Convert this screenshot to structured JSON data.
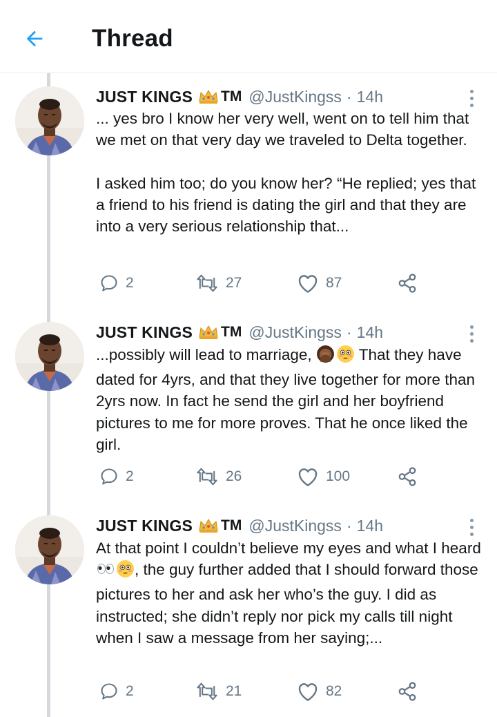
{
  "header": {
    "title": "Thread",
    "back_icon": "arrow-left-icon",
    "accent": "#1da1f2"
  },
  "tweets": [
    {
      "name": "JUST KINGS",
      "badge": "TM",
      "handle": "@JustKingss",
      "dot": "·",
      "time": "14h",
      "body": [
        "... yes bro I know her very well, went on to tell him that we met on that very day we traveled to Delta together.",
        "I asked him too; do you know her? “He replied; yes that a friend to his friend is dating the girl and that they are into a very serious relationship that..."
      ],
      "replies": "2",
      "retweets": "27",
      "likes": "87"
    },
    {
      "name": "JUST KINGS",
      "badge": "TM",
      "handle": "@JustKingss",
      "dot": "·",
      "time": "14h",
      "body_before_emoji": "...possibly will lead to marriage, ",
      "body_after_emoji": " That they have dated for 4yrs, and that they live together for more than 2yrs now. In fact he send the girl and her boyfriend pictures to me for more proves. That he once liked the girl.",
      "emojis": [
        "woman-facepalming-emoji",
        "flushed-face-emoji"
      ],
      "replies": "2",
      "retweets": "26",
      "likes": "100"
    },
    {
      "name": "JUST KINGS",
      "badge": "TM",
      "handle": "@JustKingss",
      "dot": "·",
      "time": "14h",
      "body_before_emoji": "At that point I couldn’t believe my eyes and what I heard ",
      "body_after_emoji": ", the guy further added that I should forward those pictures to her and ask her who’s the guy. I did as instructed; she didn’t reply nor pick my calls till night when I saw a message from her saying;...",
      "emojis": [
        "eyes-emoji",
        "flushed-face-emoji"
      ],
      "replies": "2",
      "retweets": "21",
      "likes": "82"
    }
  ],
  "colors": {
    "text": "#14171a",
    "secondary": "#657786",
    "icon": "#657786",
    "thread_line": "#d6d9dc"
  },
  "icons": [
    "reply-icon",
    "retweet-icon",
    "like-icon",
    "share-icon",
    "more-vertical-icon",
    "crown-icon"
  ]
}
